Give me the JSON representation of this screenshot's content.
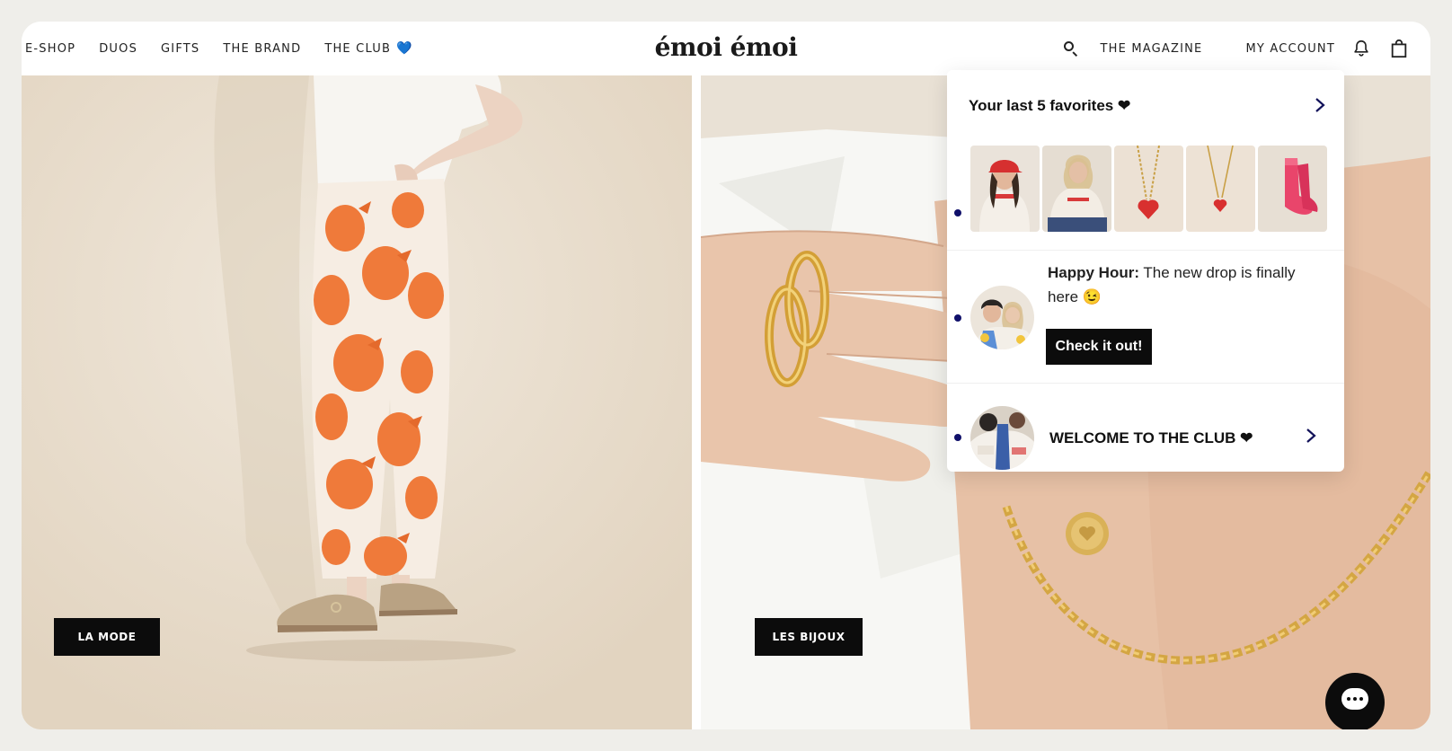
{
  "header": {
    "nav_left": [
      {
        "label": "E-SHOP"
      },
      {
        "label": "DUOS"
      },
      {
        "label": "GIFTS"
      },
      {
        "label": "THE BRAND"
      },
      {
        "label": "THE CLUB"
      }
    ],
    "logo": "émoi émoi",
    "nav_right": {
      "magazine": "THE MAGAZINE",
      "account": "MY ACCOUNT"
    },
    "icons": [
      "search-icon",
      "bell-icon",
      "shopping-bag-icon",
      "blue-heart-icon"
    ]
  },
  "hero": {
    "left_cta": "LA MODE",
    "right_cta": "LES BIJOUX"
  },
  "popup": {
    "favorites_title": "Your last 5 favorites ❤",
    "favorites": [
      {
        "name": "Girl in red cap sweater"
      },
      {
        "name": "Woman in cream sweater"
      },
      {
        "name": "Gold chain heart necklace"
      },
      {
        "name": "Gold heart pendant necklace"
      },
      {
        "name": "Pink socks"
      }
    ],
    "happy_hour": {
      "lead": "Happy Hour:",
      "text": " The new drop is finally here 😉",
      "button": "Check it out!"
    },
    "welcome": "WELCOME TO THE CLUB ❤"
  },
  "colors": {
    "accent_dark": "#0c0c0c",
    "dot_navy": "#10106a",
    "heart_blue": "#3b74e6"
  }
}
